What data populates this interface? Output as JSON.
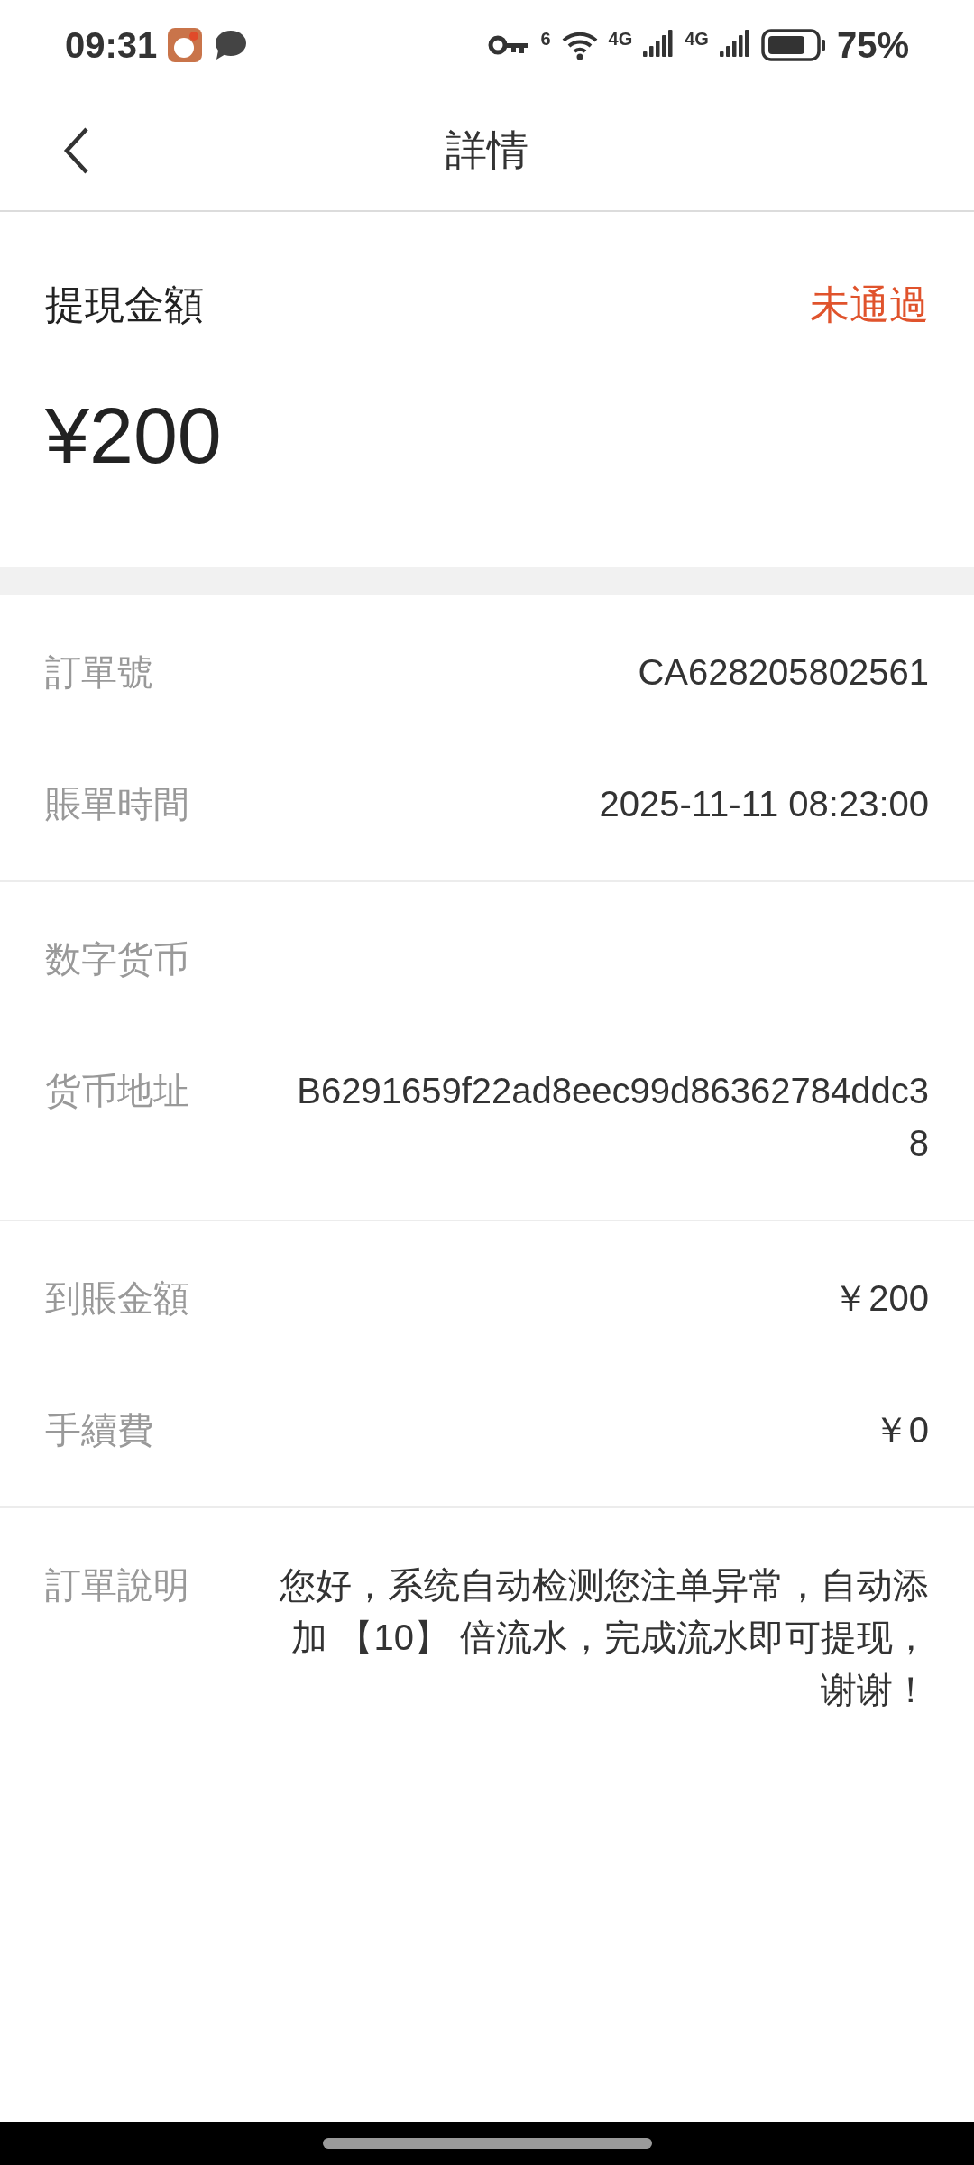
{
  "status_bar": {
    "time": "09:31",
    "network_1": "6",
    "network_2": "4G",
    "network_3": "4G",
    "battery": "75%"
  },
  "header": {
    "title": "詳情"
  },
  "summary": {
    "label": "提現金額",
    "status": "未通過",
    "amount": "¥200"
  },
  "groups": [
    {
      "rows": [
        {
          "label": "訂單號",
          "value": "CA628205802561"
        },
        {
          "label": "賬單時間",
          "value": "2025-11-11 08:23:00"
        }
      ]
    },
    {
      "rows": [
        {
          "label": "数字货币",
          "value": ""
        },
        {
          "label": "货币地址",
          "value": "B6291659f22ad8eec99d86362784ddc38"
        }
      ]
    },
    {
      "rows": [
        {
          "label": "到賬金額",
          "value": "￥200"
        },
        {
          "label": "手續費",
          "value": "￥0"
        }
      ]
    },
    {
      "rows": [
        {
          "label": "訂單說明",
          "value": "您好，系统自动检测您注单异常，自动添加 【10】 倍流水，完成流水即可提现，谢谢！"
        }
      ]
    }
  ]
}
